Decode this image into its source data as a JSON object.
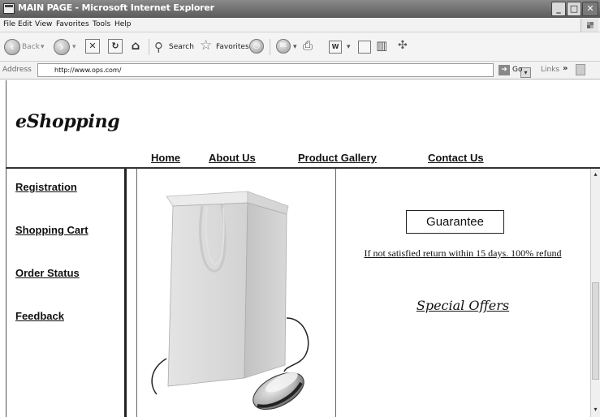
{
  "window": {
    "title": "MAIN PAGE - Microsoft Internet Explorer",
    "buttons": {
      "minimize": "_",
      "maximize": "□",
      "close": "✕"
    }
  },
  "menubar": {
    "items": [
      "File",
      "Edit",
      "View",
      "Favorites",
      "Tools",
      "Help"
    ]
  },
  "toolbar": {
    "back_label": "Back",
    "search_label": "Search",
    "favorites_label": "Favorites",
    "icons": [
      "back-icon",
      "forward-icon",
      "stop-icon",
      "refresh-icon",
      "home-icon",
      "search-icon",
      "favorites-icon",
      "history-icon",
      "mail-icon",
      "print-icon",
      "edit-icon",
      "discuss-icon",
      "research-icon",
      "messenger-icon"
    ]
  },
  "addressbar": {
    "label": "Address",
    "url": "http://www.ops.com/",
    "go_label": "Go",
    "links_label": "Links",
    "links_chevron": "»"
  },
  "page": {
    "logo": "eShopping",
    "topnav": [
      "Home",
      "About Us",
      "Product Gallery",
      "Contact Us"
    ],
    "sidenav": [
      "Registration",
      "Shopping Cart",
      "Order Status",
      "Feedback"
    ],
    "guarantee_title": "Guarantee",
    "guarantee_text": "If not satisfied return within 15 days. 100% refund",
    "special_offers": "Special Offers"
  },
  "colors": {
    "titlebar": "#6e6e6e",
    "chrome": "#f2f2f2",
    "text": "#111111"
  }
}
